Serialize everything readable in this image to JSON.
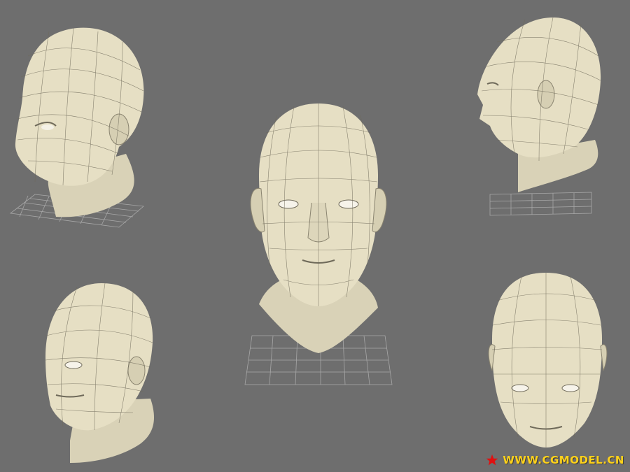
{
  "scene": {
    "background": "#6e6e6e",
    "head_color": "#e6dfc4",
    "wireframe_color": "#6f6a5a",
    "grid_color": "#a8a8a8",
    "views": [
      {
        "name": "three-quarter-left-high"
      },
      {
        "name": "front"
      },
      {
        "name": "profile-left"
      },
      {
        "name": "three-quarter-left-low"
      },
      {
        "name": "top-down-tilted"
      }
    ]
  },
  "watermark": {
    "text": "WWW.CGMODEL.CN",
    "star_icon": "red-star-icon",
    "text_color": "#ffd21a",
    "star_color": "#e01010"
  }
}
